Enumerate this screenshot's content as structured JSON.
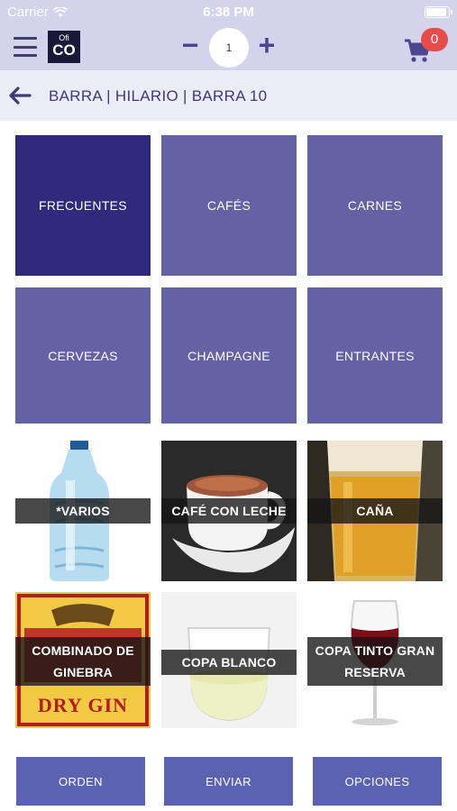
{
  "status_bar": {
    "carrier": "Carrier",
    "time": "6:38 PM",
    "battery_level": 0.95
  },
  "header": {
    "logo_top": "Ofi",
    "logo_bottom": "CO",
    "quantity": "1",
    "minus_label": "−",
    "plus_label": "+",
    "cart_count": "0",
    "accent_color": "#4b468f",
    "badge_color": "#e74c4c"
  },
  "breadcrumb": {
    "text": "BARRA | HILARIO | BARRA 10"
  },
  "categories": [
    {
      "label": "FRECUENTES",
      "active": true
    },
    {
      "label": "CAFÉS",
      "active": false
    },
    {
      "label": "CARNES",
      "active": false
    },
    {
      "label": "CERVEZAS",
      "active": false
    },
    {
      "label": "CHAMPAGNE",
      "active": false
    },
    {
      "label": "ENTRANTES",
      "active": false
    }
  ],
  "products": [
    {
      "label": "*VARIOS",
      "image": "water-bottle"
    },
    {
      "label": "CAFÉ CON LECHE",
      "image": "coffee-cup"
    },
    {
      "label": "CAÑA",
      "image": "beer-glass"
    },
    {
      "label": "COMBINADO DE GINEBRA",
      "image": "gin-bottle",
      "image_text": "DRY GIN"
    },
    {
      "label": "COPA BLANCO",
      "image": "white-wine-glass"
    },
    {
      "label": "COPA TINTO GRAN RESERVA",
      "image": "red-wine-glass"
    }
  ],
  "actions": {
    "orden": "ORDEN",
    "enviar": "ENVIAR",
    "opciones": "OPCIONES"
  },
  "colors": {
    "category_tile": "#6461a5",
    "category_active": "#2e2a7c",
    "action_button": "#5b63b0"
  }
}
